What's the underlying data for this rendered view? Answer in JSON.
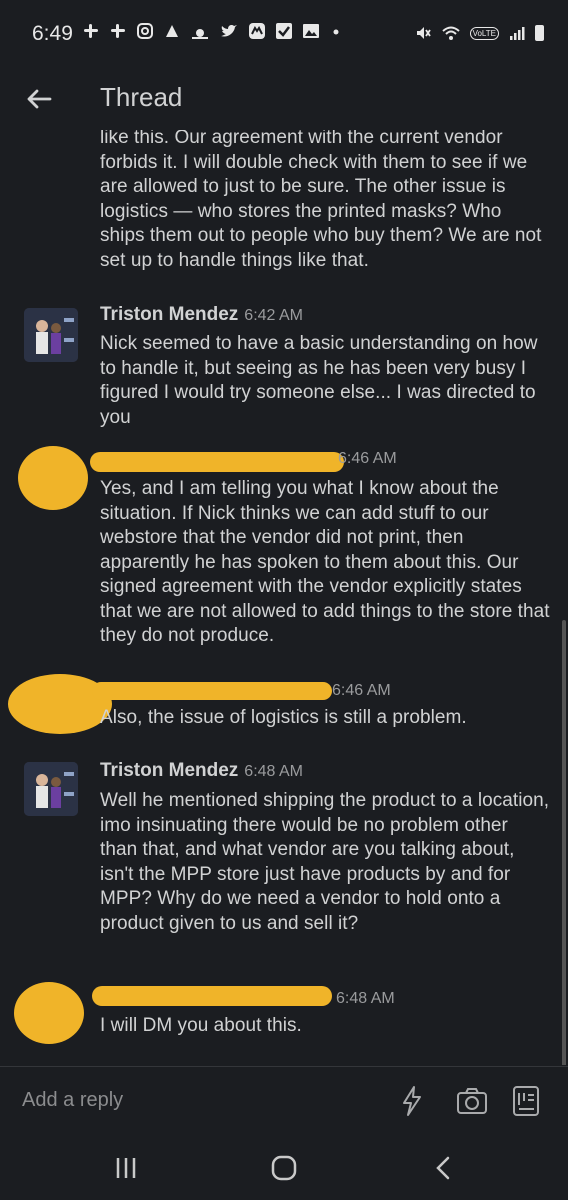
{
  "status_bar": {
    "time": "6:49",
    "left_icons": [
      "slack-icon",
      "slack-icon",
      "instagram-icon",
      "notification-icon",
      "weather-icon",
      "twitter-icon",
      "messenger-icon",
      "checkbox-icon",
      "gallery-icon",
      "dot-icon"
    ],
    "right_icons": [
      "mute-icon",
      "wifi-icon",
      "volte-icon",
      "signal-icon",
      "battery-icon"
    ],
    "volte_label": "VoLTE"
  },
  "header": {
    "title": "Thread"
  },
  "messages": [
    {
      "id": "cont",
      "text": "like this. Our agreement with the current vendor forbids it. I will double check with them to see if we are allowed to just to be sure. The other issue is logistics — who stores the printed masks? Who ships them out to people who buy them? We are not set up to handle things like that."
    },
    {
      "id": "m1",
      "author": "Triston Mendez",
      "time": "6:42 AM",
      "text": "Nick seemed to have a basic understanding on how to handle it, but seeing as he has been very busy I figured I would try someone else... I was directed to you"
    },
    {
      "id": "m2",
      "author": "",
      "time": "6:46 AM",
      "redacted": true,
      "text": "Yes, and I am telling you what I know about the situation. If Nick thinks we can add stuff to our webstore that the vendor did not print, then apparently he has spoken to them about this. Our signed agreement with the vendor explicitly states that we are not allowed to add things to the store that they do not produce."
    },
    {
      "id": "m3",
      "author": "",
      "time": "6:46 AM",
      "redacted": true,
      "text": "Also, the issue of logistics is still a problem."
    },
    {
      "id": "m4",
      "author": "Triston Mendez",
      "time": "6:48 AM",
      "text": "Well he mentioned shipping the product to a location, imo insinuating there would be no problem other than that, and what vendor are you talking about, isn't the MPP store just have products by and for MPP? Why do we need a vendor to hold onto a product given to us and sell it?"
    },
    {
      "id": "m5",
      "author": "",
      "time": "6:48 AM",
      "redacted": true,
      "text": "I will DM you about this."
    }
  ],
  "composer": {
    "placeholder": "Add a reply",
    "icons": [
      "shortcut-lightning-icon",
      "camera-icon",
      "attachment-icon"
    ]
  },
  "nav_bar": {
    "icons": [
      "recent-apps-icon",
      "home-icon",
      "back-nav-icon"
    ]
  },
  "colors": {
    "background": "#1b1d21",
    "text": "#d1d2d3",
    "muted": "#9a9b9d",
    "redaction": "#f0b429"
  }
}
